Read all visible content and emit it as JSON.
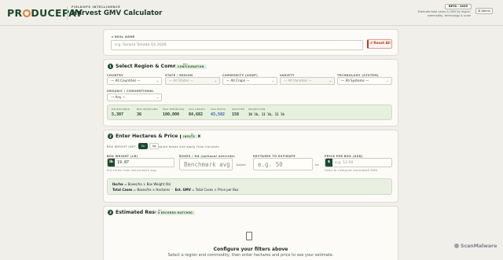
{
  "header": {
    "logo": "PRODUCEPAY",
    "eyebrow": "FIELDOPS INTELLIGENCE",
    "title": "Harvest GMV Calculator",
    "badge": "BETA · 2025",
    "subtitle": "Estimate total cases & GMV by region, commodity, technology & scale",
    "admin": "⚙ Admin"
  },
  "deal": {
    "label": "⌗ DEAL NAME",
    "placeholder": "e.g. Sonora Tomato Q1 2026",
    "reset": "↺ Reset All"
  },
  "step1": {
    "num": "1",
    "title": "Select Region & Commodity",
    "tag": "CONFIGURATION",
    "filters": [
      {
        "label": "COUNTRY",
        "value": "— All Countries —",
        "disabled": false
      },
      {
        "label": "STATE / REGION",
        "value": "— All States —",
        "disabled": true
      },
      {
        "label": "COMMODITY (USDP)",
        "value": "— All Crops —",
        "disabled": false
      },
      {
        "label": "VARIETY",
        "value": "— All Varieties —",
        "disabled": true
      },
      {
        "label": "TECHNOLOGY (SYSTEM)",
        "value": "— All Systems —",
        "disabled": false
      }
    ],
    "organic": {
      "label": "ORGANIC / CONVENTIONAL",
      "value": "— Any —"
    },
    "stats": [
      {
        "k": "DB RECORDS",
        "v": "5,307"
      },
      {
        "k": "BOX MODELING",
        "v": "36"
      },
      {
        "k": "MAX MODELING",
        "v": "100,000"
      },
      {
        "k": "AVG LBS/HA",
        "v": "84,682"
      },
      {
        "k": "AVG BX/HA",
        "v": "43,582"
      },
      {
        "k": "MATCHES",
        "v": "158"
      },
      {
        "k": "PROJECTION",
        "v": "10 lb, 11 lb, 11 lb"
      }
    ]
  },
  "step2": {
    "num": "2",
    "title": "Enter Hectares & Price per Box",
    "tag": "INPUTS",
    "unit_label": "BOX WEIGHT UNIT: lb / kg — compute boxes and apply from harvests",
    "unit_lb": "lb",
    "unit_kg": "kg",
    "box_weight_label": "BOX WEIGHT (LB)",
    "box_weight_value": "19.87",
    "box_weight_prefix": "lb",
    "box_weight_hint": "Pre-filled from benchmark avg",
    "boxes_label": "BOXES / HA (optional override)",
    "boxes_placeholder": "Benchmark avg",
    "boxes_unit": "boxes",
    "hectares_label": "HECTARES TO ESTIMATE",
    "hectares_placeholder": "e.g. 50",
    "hectares_unit": "ha",
    "price_label": "PRICE PER BOX (USD)",
    "price_prefix": "$",
    "price_placeholder": "e.g. 12.50",
    "price_hint": "Used to compute estimated GMV",
    "formula_line1_a": "lbs/ha",
    "formula_line1_b": "= Boxes/ha × Box Weight (lb)",
    "formula_line2_a": "Total Cases",
    "formula_line2_b": "= Boxes/ha × Hectares",
    "formula_line2_c": "Est. GMV",
    "formula_line2_d": "= Total Cases × Price per Box"
  },
  "step3": {
    "num": "3",
    "title": "Estimated Results",
    "tag": "0 RECORDS MATCHED",
    "empty_title": "Configure your filters above",
    "empty_sub": "Select a region and commodity, then enter hectares and price to see your estimate."
  },
  "watermark": "ScanMalware",
  "colors": {
    "brand_green": "#1d4a2c",
    "accent_orange": "#e57c2f",
    "reset_red": "#b23a2a"
  }
}
